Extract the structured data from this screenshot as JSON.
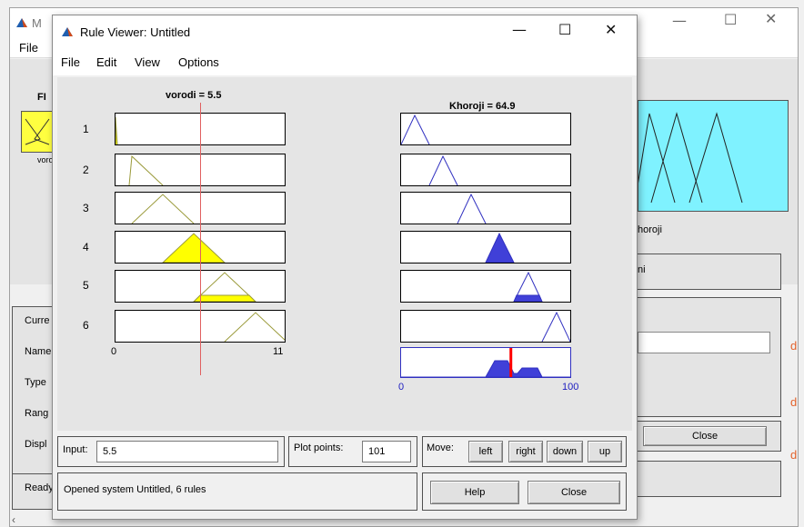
{
  "background_window": {
    "title_initial": "M",
    "menu_file": "File",
    "left_label_top": "FI",
    "input_var_fragment": "voro",
    "output_var_fragment": "horoji",
    "panel_fragment_ni": "ni",
    "side_labels": [
      "Curre",
      "Name",
      "Type",
      "Rang",
      "Displ",
      "Ready"
    ],
    "close_button": "Close",
    "orange_marks": [
      "d",
      "d",
      "d"
    ]
  },
  "rule_viewer": {
    "title": "Rule Viewer: Untitled",
    "menu": [
      "File",
      "Edit",
      "View",
      "Options"
    ],
    "input_header": "vorodi = 5.5",
    "output_header": "Khoroji = 64.9",
    "rule_numbers": [
      "1",
      "2",
      "3",
      "4",
      "5",
      "6"
    ],
    "input_axis": {
      "min": "0",
      "max": "11"
    },
    "output_axis": {
      "min": "0",
      "max": "100"
    },
    "input_value": 5.5,
    "output_value": 64.9,
    "controls": {
      "input_label": "Input:",
      "input_field": "5.5",
      "plot_points_label": "Plot points:",
      "plot_points_value": "101",
      "move_label": "Move:",
      "move_buttons": [
        "left",
        "right",
        "down",
        "up"
      ],
      "status": "Opened system Untitled, 6 rules",
      "help_button": "Help",
      "close_button": "Close"
    },
    "colors": {
      "accent_fill": "#ffff00",
      "output_fill": "#4040d8",
      "output_line": "#ff0000",
      "input_line": "#e06060",
      "olive": "#9a9a3a",
      "blue": "#3030c0"
    }
  }
}
